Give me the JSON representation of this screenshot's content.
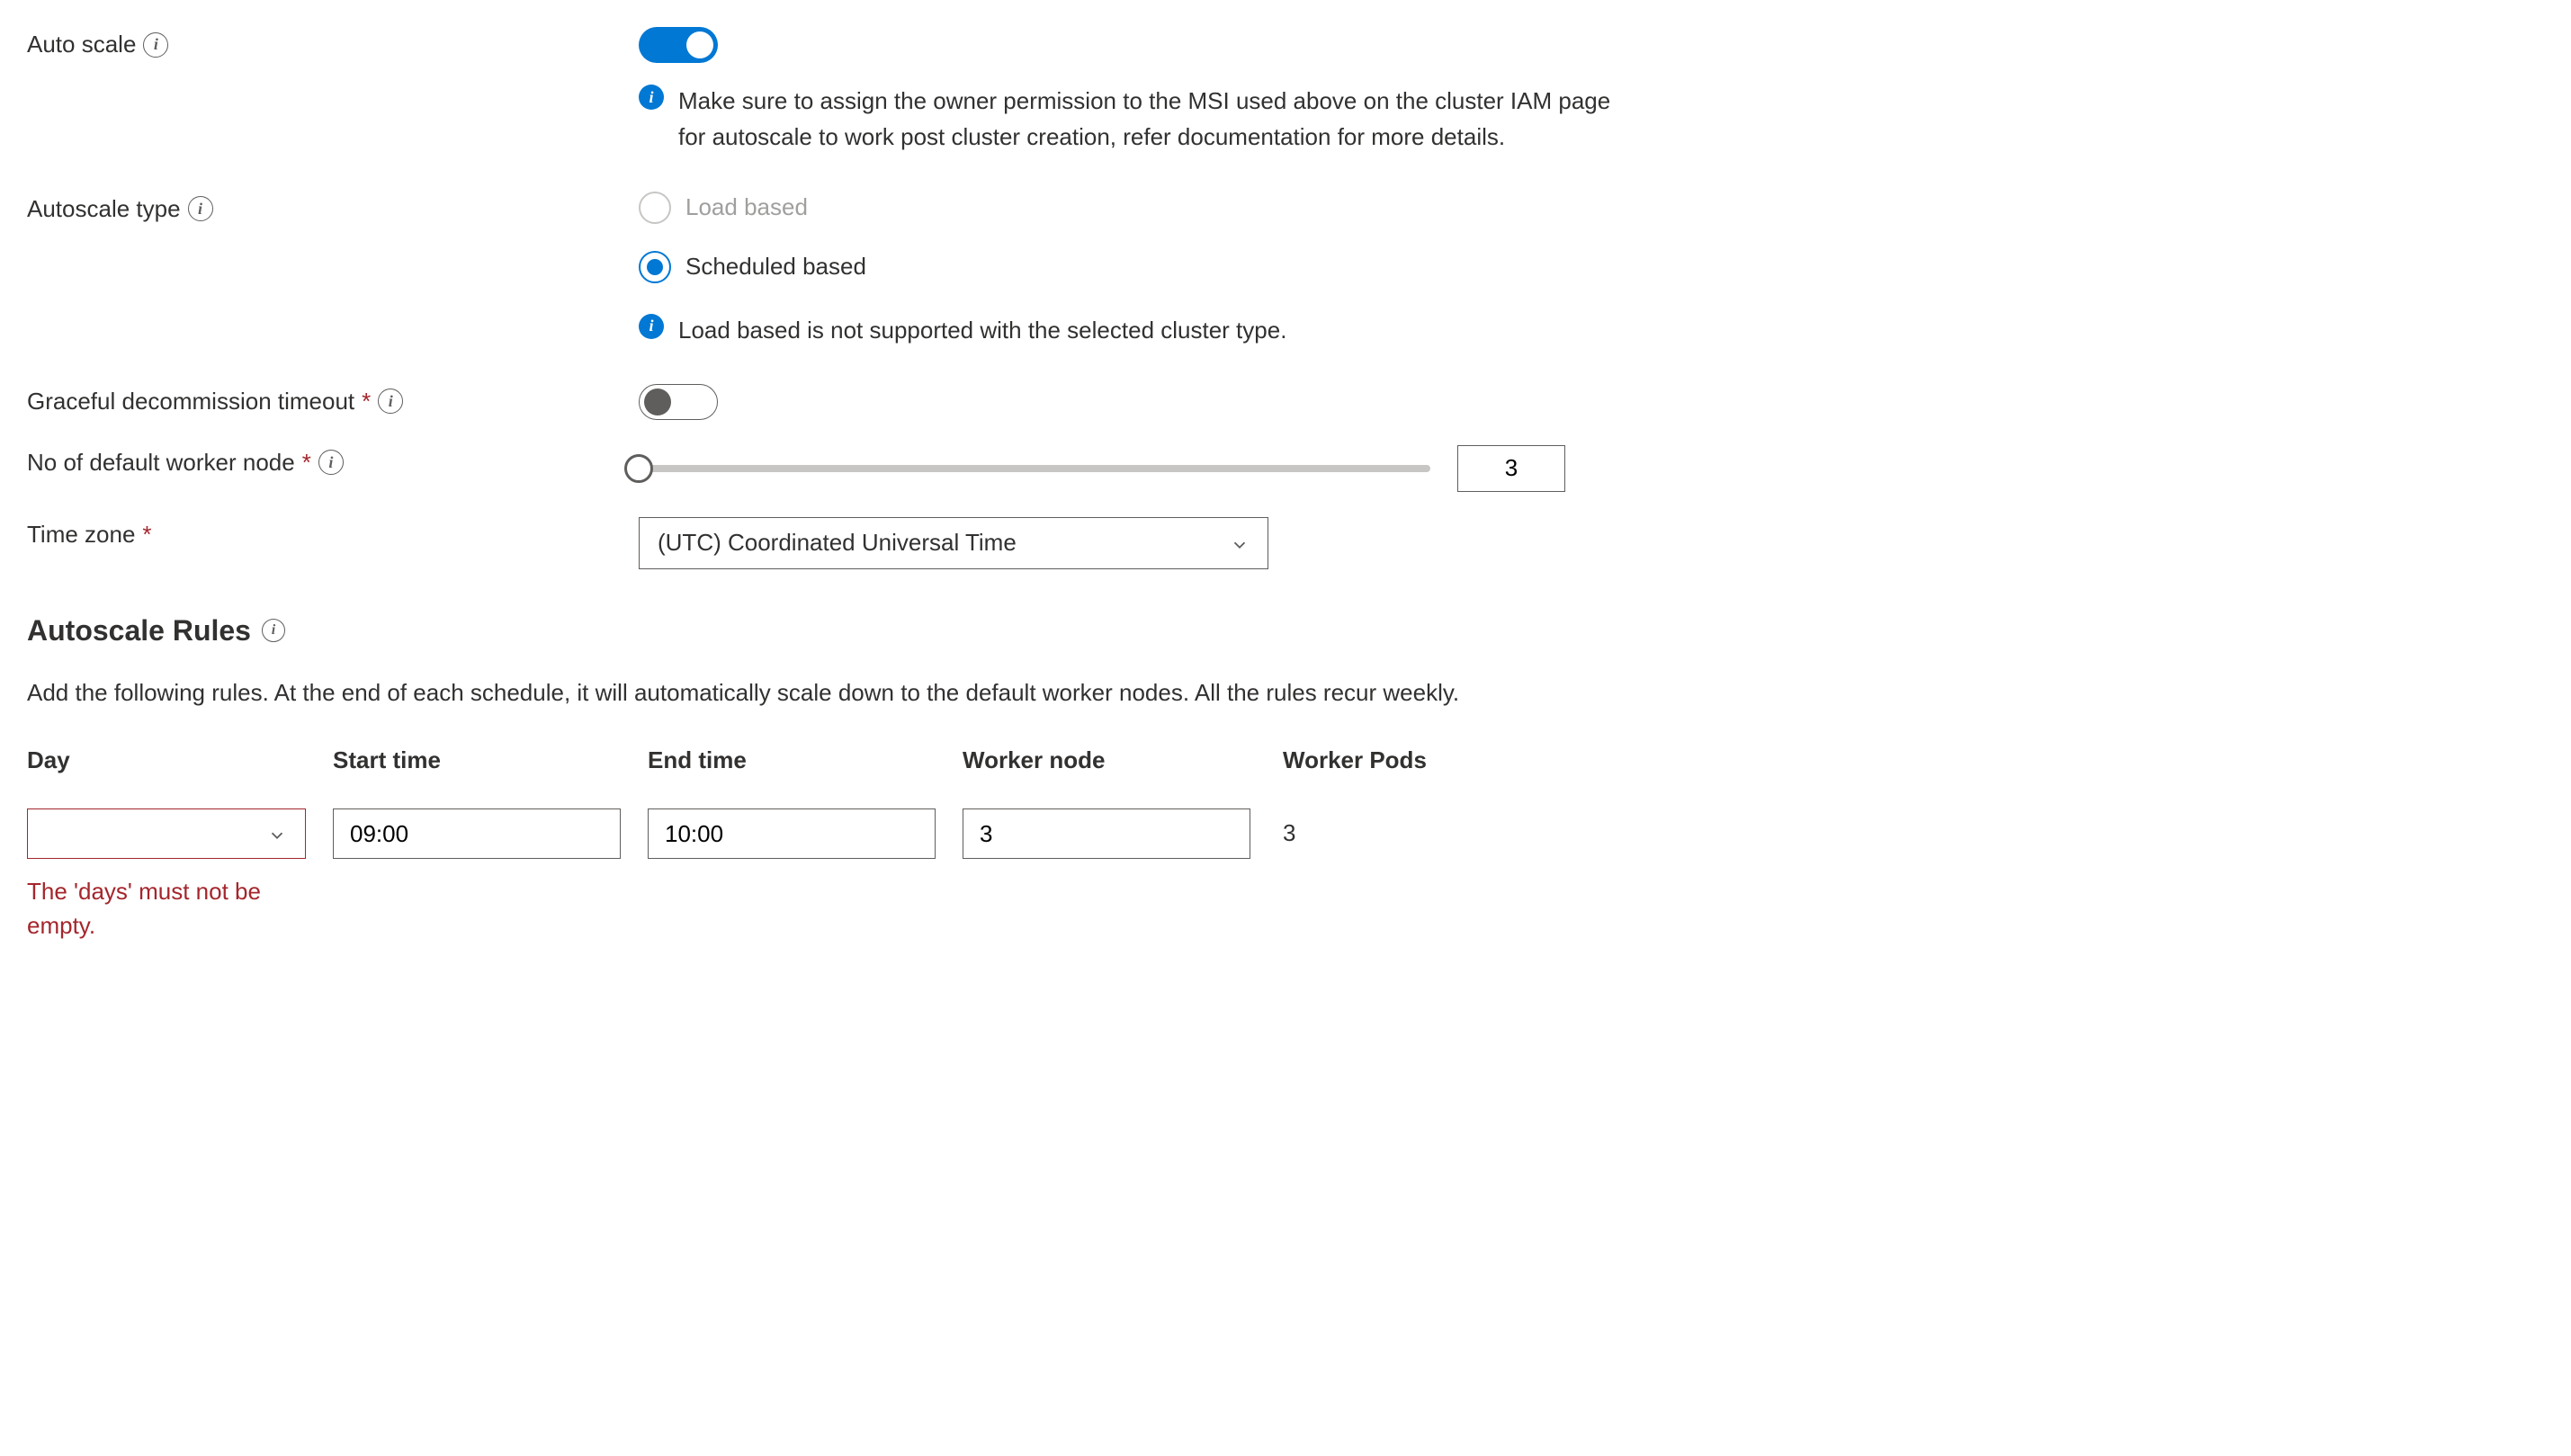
{
  "autoscale": {
    "label": "Auto scale",
    "enabled": true,
    "msi_warning": "Make sure to assign the owner permission to the MSI used above on the cluster IAM page for autoscale to work post cluster creation, refer documentation for more details."
  },
  "autoscale_type": {
    "label": "Autoscale type",
    "options": {
      "load_based": "Load based",
      "scheduled_based": "Scheduled based"
    },
    "selected": "scheduled_based",
    "load_based_disabled": true,
    "load_not_supported_msg": "Load based is not supported with the selected cluster type."
  },
  "graceful_decommission": {
    "label": "Graceful decommission timeout",
    "enabled": false
  },
  "default_worker_node": {
    "label": "No of default worker node",
    "value": "3"
  },
  "timezone": {
    "label": "Time zone",
    "selected": "(UTC) Coordinated Universal Time"
  },
  "rules_section": {
    "heading": "Autoscale Rules",
    "description": "Add the following rules. At the end of each schedule, it will automatically scale down to the default worker nodes. All the rules recur weekly.",
    "columns": {
      "day": "Day",
      "start_time": "Start time",
      "end_time": "End time",
      "worker_node": "Worker node",
      "worker_pods": "Worker Pods"
    },
    "row": {
      "day": "",
      "start_time": "09:00",
      "end_time": "10:00",
      "worker_node": "3",
      "worker_pods": "3"
    },
    "day_error": "The 'days' must not be empty."
  }
}
